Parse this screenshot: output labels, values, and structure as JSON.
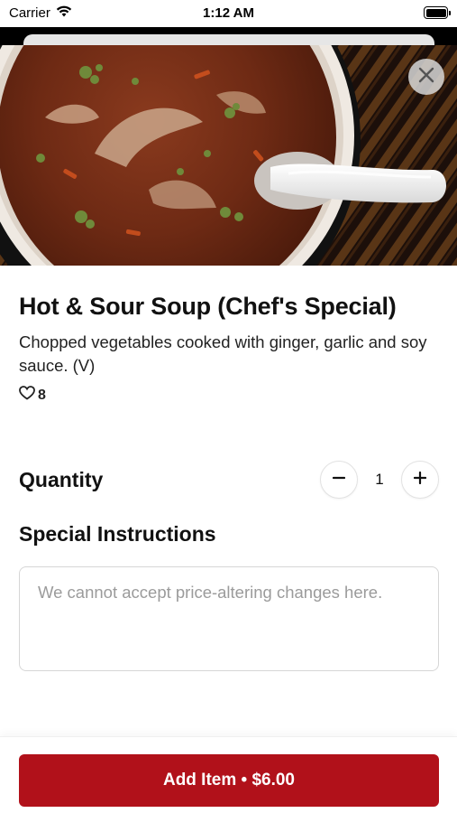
{
  "status_bar": {
    "carrier": "Carrier",
    "time": "1:12 AM"
  },
  "item": {
    "title": "Hot & Sour Soup (Chef's Special)",
    "description": "Chopped vegetables cooked with ginger, garlic and soy sauce. (V)",
    "likes": "8"
  },
  "quantity": {
    "label": "Quantity",
    "value": "1"
  },
  "instructions": {
    "label": "Special Instructions",
    "placeholder": "We cannot accept price-altering changes here.",
    "value": ""
  },
  "footer": {
    "add_button": "Add Item • $6.00"
  },
  "colors": {
    "accent": "#b1111a",
    "text": "#111111",
    "placeholder": "#9b9b9b"
  },
  "icons": [
    "wifi-icon",
    "battery-icon",
    "close-icon",
    "heart-icon",
    "minus-icon",
    "plus-icon"
  ]
}
